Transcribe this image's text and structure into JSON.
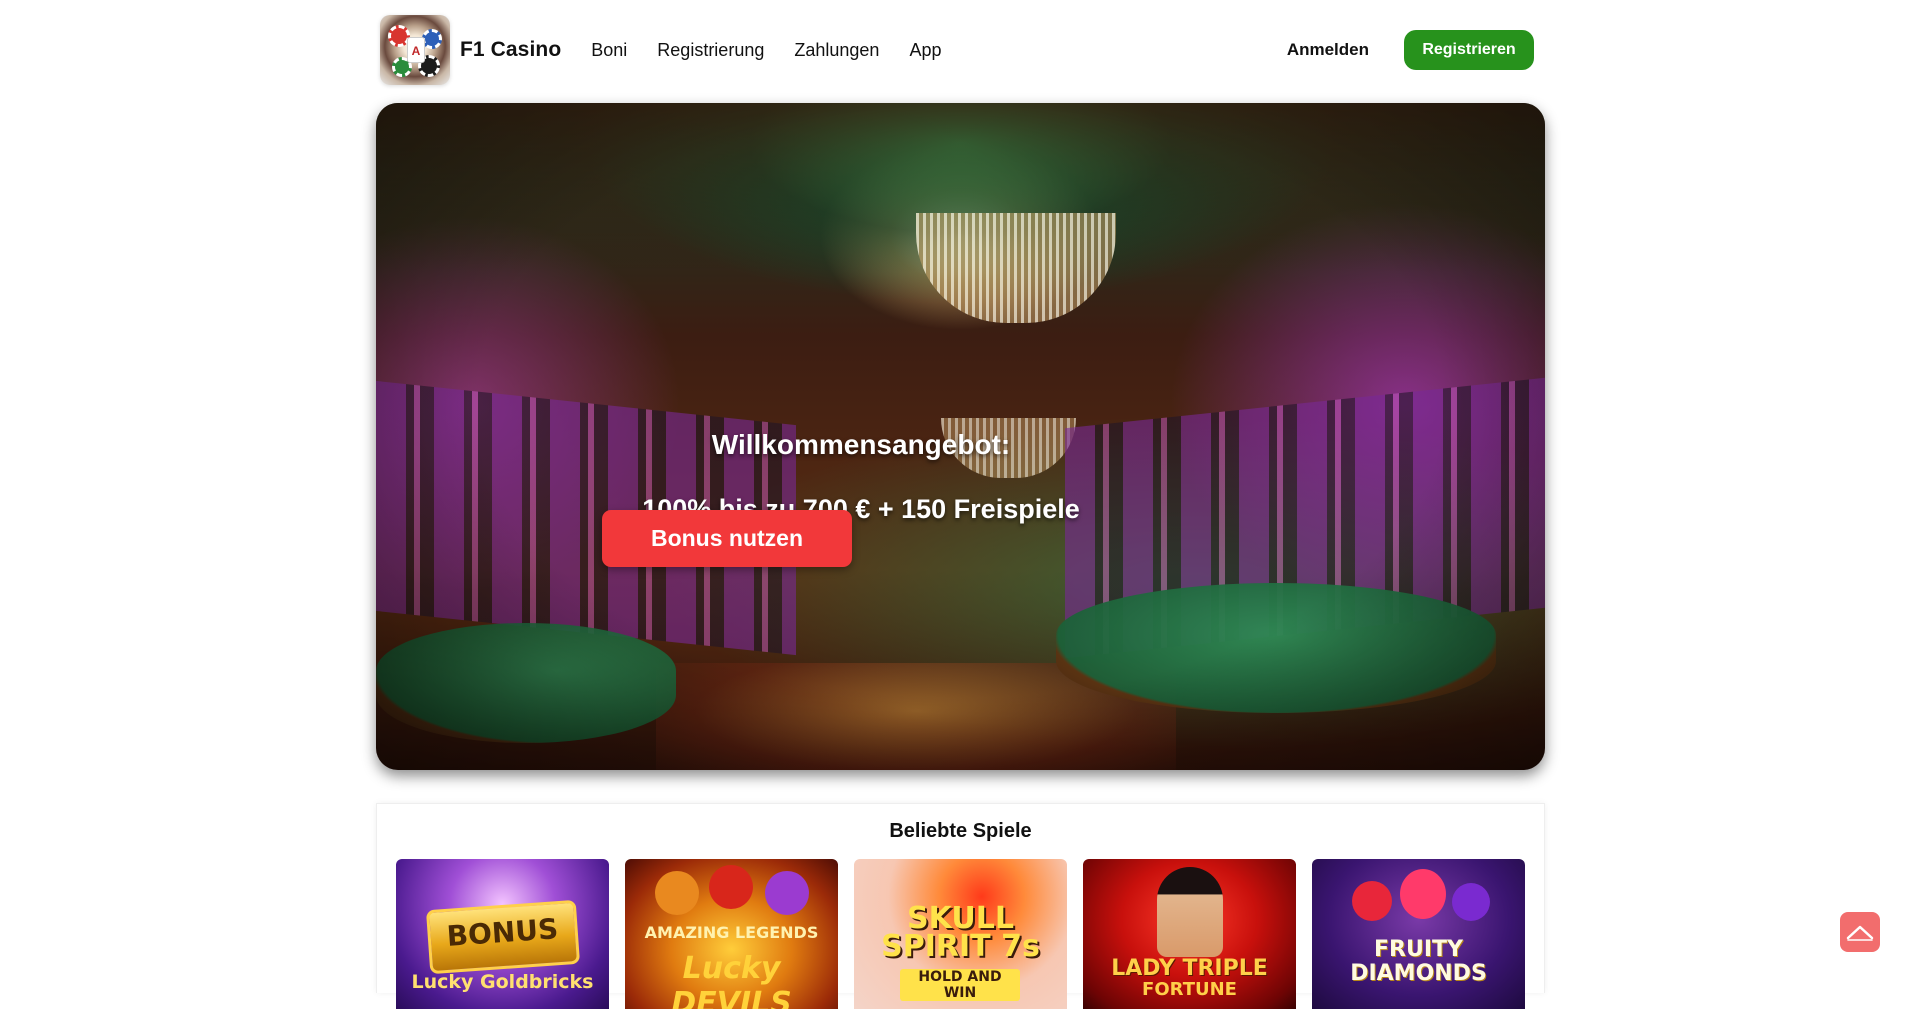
{
  "header": {
    "logo_icon": "casino-chips-logo-icon",
    "brand": "F1 Casino",
    "nav": [
      {
        "label": "Boni"
      },
      {
        "label": "Registrierung"
      },
      {
        "label": "Zahlungen"
      },
      {
        "label": "App"
      }
    ],
    "login_label": "Anmelden",
    "register_label": "Registrieren",
    "register_color": "#27921c"
  },
  "hero": {
    "title": "Willkommensangebot:",
    "subtitle": "100% bis zu 700 € + 150 Freispiele",
    "cta_label": "Bonus nutzen",
    "cta_color": "#f2383a"
  },
  "games": {
    "title": "Beliebte Spiele",
    "items": [
      {
        "name": "BONUS",
        "sub": "Lucky Goldbricks"
      },
      {
        "name": "AMAZING LEGENDS",
        "sub": "Lucky DEVILS"
      },
      {
        "name": "SKULL SPIRIT 7s",
        "sub": "HOLD AND WIN"
      },
      {
        "name": "LADY TRIPLE",
        "sub": "FORTUNE"
      },
      {
        "name": "FRUITY",
        "sub": "DIAMONDS"
      }
    ]
  },
  "back_to_top": {
    "icon": "chevron-up-icon",
    "color": "#f26d6d"
  }
}
